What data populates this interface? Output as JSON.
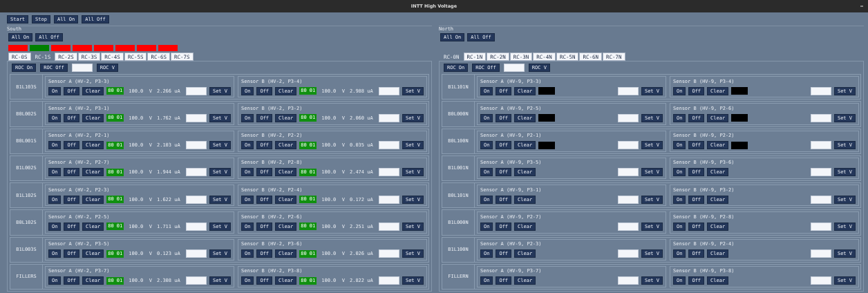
{
  "window": {
    "title": "INTT High Voltage"
  },
  "toolbar": [
    "Start",
    "Stop",
    "All On",
    "All Off"
  ],
  "sides": [
    {
      "name": "South",
      "buttons": [
        "All On",
        "All Off"
      ],
      "indicators": [
        {
          "color": "#ff0000"
        },
        {
          "color": "#008000"
        },
        {
          "color": "#ff0000"
        },
        {
          "color": "#ff0000"
        },
        {
          "color": "#ff0000"
        },
        {
          "color": "#ff0000"
        },
        {
          "color": "#ff0000"
        },
        {
          "color": "#ff0000"
        }
      ],
      "tabs": [
        {
          "label": "RC-0S",
          "selected": false
        },
        {
          "label": "RC-1S",
          "selected": true
        },
        {
          "label": "RC-2S",
          "selected": false
        },
        {
          "label": "RC-3S",
          "selected": false
        },
        {
          "label": "RC-4S",
          "selected": false
        },
        {
          "label": "RC-5S",
          "selected": false
        },
        {
          "label": "RC-6S",
          "selected": false
        },
        {
          "label": "RC-7S",
          "selected": false
        }
      ],
      "roc": {
        "on": "ROC On",
        "off": "ROC Off",
        "set": "ROC V"
      },
      "ladders": [
        {
          "name": "B1L103S",
          "sensors": [
            {
              "title": "Sensor A (HV-2, P3-3)",
              "kind": "readout",
              "buttons": [
                "On",
                "Off",
                "Clear"
              ],
              "status": "80 01",
              "voltage": "100.0  V",
              "current": "2.266 uA",
              "set": "Set V"
            },
            {
              "title": "Sensor B (HV-2, P3-4)",
              "kind": "readout",
              "buttons": [
                "On",
                "Off",
                "Clear"
              ],
              "status": "80 01",
              "voltage": "100.0  V",
              "current": "2.988 uA",
              "set": "Set V"
            }
          ]
        },
        {
          "name": "B0L002S",
          "sensors": [
            {
              "title": "Sensor A (HV-2, P3-1)",
              "kind": "readout",
              "buttons": [
                "On",
                "Off",
                "Clear"
              ],
              "status": "80 01",
              "voltage": "100.0  V",
              "current": "1.762 uA",
              "set": "Set V"
            },
            {
              "title": "Sensor B (HV-2, P3-2)",
              "kind": "readout",
              "buttons": [
                "On",
                "Off",
                "Clear"
              ],
              "status": "80 01",
              "voltage": "100.0  V",
              "current": "2.060 uA",
              "set": "Set V"
            }
          ]
        },
        {
          "name": "B0L001S",
          "sensors": [
            {
              "title": "Sensor A (HV-2, P2-1)",
              "kind": "readout",
              "buttons": [
                "On",
                "Off",
                "Clear"
              ],
              "status": "80 01",
              "voltage": "100.0  V",
              "current": "2.103 uA",
              "set": "Set V"
            },
            {
              "title": "Sensor B (HV-2, P2-2)",
              "kind": "readout",
              "buttons": [
                "On",
                "Off",
                "Clear"
              ],
              "status": "80 01",
              "voltage": "100.0  V",
              "current": "0.035 uA",
              "set": "Set V"
            }
          ]
        },
        {
          "name": "B1L002S",
          "sensors": [
            {
              "title": "Sensor A (HV-2, P2-7)",
              "kind": "readout",
              "buttons": [
                "On",
                "Off",
                "Clear"
              ],
              "status": "80 01",
              "voltage": "100.0  V",
              "current": "1.944 uA",
              "set": "Set V"
            },
            {
              "title": "Sensor B (HV-2, P2-8)",
              "kind": "readout",
              "buttons": [
                "On",
                "Off",
                "Clear"
              ],
              "status": "80 01",
              "voltage": "100.0  V",
              "current": "2.474 uA",
              "set": "Set V"
            }
          ]
        },
        {
          "name": "B1L102S",
          "sensors": [
            {
              "title": "Sensor A (HV-2, P2-3)",
              "kind": "readout",
              "buttons": [
                "On",
                "Off",
                "Clear"
              ],
              "status": "80 01",
              "voltage": "100.0  V",
              "current": "1.622 uA",
              "set": "Set V"
            },
            {
              "title": "Sensor B (HV-2, P2-4)",
              "kind": "readout",
              "buttons": [
                "On",
                "Off",
                "Clear"
              ],
              "status": "80 01",
              "voltage": "100.0  V",
              "current": "0.172 uA",
              "set": "Set V"
            }
          ]
        },
        {
          "name": "B0L102S",
          "sensors": [
            {
              "title": "Sensor A (HV-2, P2-5)",
              "kind": "readout",
              "buttons": [
                "On",
                "Off",
                "Clear"
              ],
              "status": "80 01",
              "voltage": "100.0  V",
              "current": "1.711 uA",
              "set": "Set V"
            },
            {
              "title": "Sensor B (HV-2, P2-6)",
              "kind": "readout",
              "buttons": [
                "On",
                "Off",
                "Clear"
              ],
              "status": "80 01",
              "voltage": "100.0  V",
              "current": "2.251 uA",
              "set": "Set V"
            }
          ]
        },
        {
          "name": "B1L003S",
          "sensors": [
            {
              "title": "Sensor A (HV-2, P3-5)",
              "kind": "readout",
              "buttons": [
                "On",
                "Off",
                "Clear"
              ],
              "status": "80 01",
              "voltage": "100.0  V",
              "current": "0.123 uA",
              "set": "Set V"
            },
            {
              "title": "Sensor B (HV-2, P3-6)",
              "kind": "readout",
              "buttons": [
                "On",
                "Off",
                "Clear"
              ],
              "status": "80 01",
              "voltage": "100.0  V",
              "current": "2.026 uA",
              "set": "Set V"
            }
          ]
        },
        {
          "name": "FILLERS",
          "sensors": [
            {
              "title": "Sensor A (HV-2, P3-7)",
              "kind": "readout",
              "buttons": [
                "On",
                "Off",
                "Clear"
              ],
              "status": "80 01",
              "voltage": "100.0  V",
              "current": "2.308 uA",
              "set": "Set V"
            },
            {
              "title": "Sensor B (HV-2, P3-8)",
              "kind": "readout",
              "buttons": [
                "On",
                "Off",
                "Clear"
              ],
              "status": "80 01",
              "voltage": "100.0  V",
              "current": "2.822 uA",
              "set": "Set V"
            }
          ]
        }
      ]
    },
    {
      "name": "North",
      "buttons": [
        "All On",
        "All Off"
      ],
      "tabs": [
        {
          "label": "RC-0N",
          "selected": true
        },
        {
          "label": "RC-1N",
          "selected": false
        },
        {
          "label": "RC-2N",
          "selected": false
        },
        {
          "label": "RC-3N",
          "selected": false
        },
        {
          "label": "RC-4N",
          "selected": false
        },
        {
          "label": "RC-5N",
          "selected": false
        },
        {
          "label": "RC-6N",
          "selected": false
        },
        {
          "label": "RC-7N",
          "selected": false
        }
      ],
      "roc": {
        "on": "ROC On",
        "off": "ROC Off",
        "set": "ROC V"
      },
      "ladders": [
        {
          "name": "B1L101N",
          "sensors": [
            {
              "title": "Sensor A (HV-9, P3-3)",
              "kind": "dark",
              "buttons": [
                "On",
                "Off",
                "Clear"
              ],
              "set": "Set V"
            },
            {
              "title": "Sensor B (HV-9, P3-4)",
              "kind": "dark",
              "buttons": [
                "On",
                "Off",
                "Clear"
              ],
              "set": "Set V"
            }
          ]
        },
        {
          "name": "B0L000N",
          "sensors": [
            {
              "title": "Sensor A (HV-9, P2-5)",
              "kind": "dark",
              "buttons": [
                "On",
                "Off",
                "Clear"
              ],
              "set": "Set V"
            },
            {
              "title": "Sensor B (HV-9, P2-6)",
              "kind": "dark",
              "buttons": [
                "On",
                "Off",
                "Clear"
              ],
              "set": "Set V"
            }
          ]
        },
        {
          "name": "B0L100N",
          "sensors": [
            {
              "title": "Sensor A (HV-9, P2-1)",
              "kind": "dark",
              "buttons": [
                "On",
                "Off",
                "Clear"
              ],
              "set": "Set V"
            },
            {
              "title": "Sensor B (HV-9, P2-2)",
              "kind": "dark",
              "buttons": [
                "On",
                "Off",
                "Clear"
              ],
              "set": "Set V"
            }
          ]
        },
        {
          "name": "B1L001N",
          "sensors": [
            {
              "title": "Sensor A (HV-9, P3-5)",
              "kind": "plain",
              "buttons": [
                "On",
                "Off",
                "Clear"
              ],
              "set": "Set V"
            },
            {
              "title": "Sensor B (HV-9, P3-6)",
              "kind": "plain",
              "buttons": [
                "On",
                "Off",
                "Clear"
              ],
              "set": "Set V"
            }
          ]
        },
        {
          "name": "B0L101N",
          "sensors": [
            {
              "title": "Sensor A (HV-9, P3-1)",
              "kind": "plain",
              "buttons": [
                "On",
                "Off",
                "Clear"
              ],
              "set": "Set V"
            },
            {
              "title": "Sensor B (HV-9, P3-2)",
              "kind": "plain",
              "buttons": [
                "On",
                "Off",
                "Clear"
              ],
              "set": "Set V"
            }
          ]
        },
        {
          "name": "B1L000N",
          "sensors": [
            {
              "title": "Sensor A (HV-9, P2-7)",
              "kind": "plain",
              "buttons": [
                "On",
                "Off",
                "Clear"
              ],
              "set": "Set V"
            },
            {
              "title": "Sensor B (HV-9, P2-8)",
              "kind": "plain",
              "buttons": [
                "On",
                "Off",
                "Clear"
              ],
              "set": "Set V"
            }
          ]
        },
        {
          "name": "B1L100N",
          "sensors": [
            {
              "title": "Sensor A (HV-9, P2-3)",
              "kind": "plain",
              "buttons": [
                "On",
                "Off",
                "Clear"
              ],
              "set": "Set V"
            },
            {
              "title": "Sensor B (HV-9, P2-4)",
              "kind": "plain",
              "buttons": [
                "On",
                "Off",
                "Clear"
              ],
              "set": "Set V"
            }
          ]
        },
        {
          "name": "FILLERN",
          "sensors": [
            {
              "title": "Sensor A (HV-9, P3-7)",
              "kind": "plain",
              "buttons": [
                "On",
                "Off",
                "Clear"
              ],
              "set": "Set V"
            },
            {
              "title": "Sensor B (HV-9, P3-8)",
              "kind": "plain",
              "buttons": [
                "On",
                "Off",
                "Clear"
              ],
              "set": "Set V"
            }
          ]
        }
      ]
    }
  ]
}
